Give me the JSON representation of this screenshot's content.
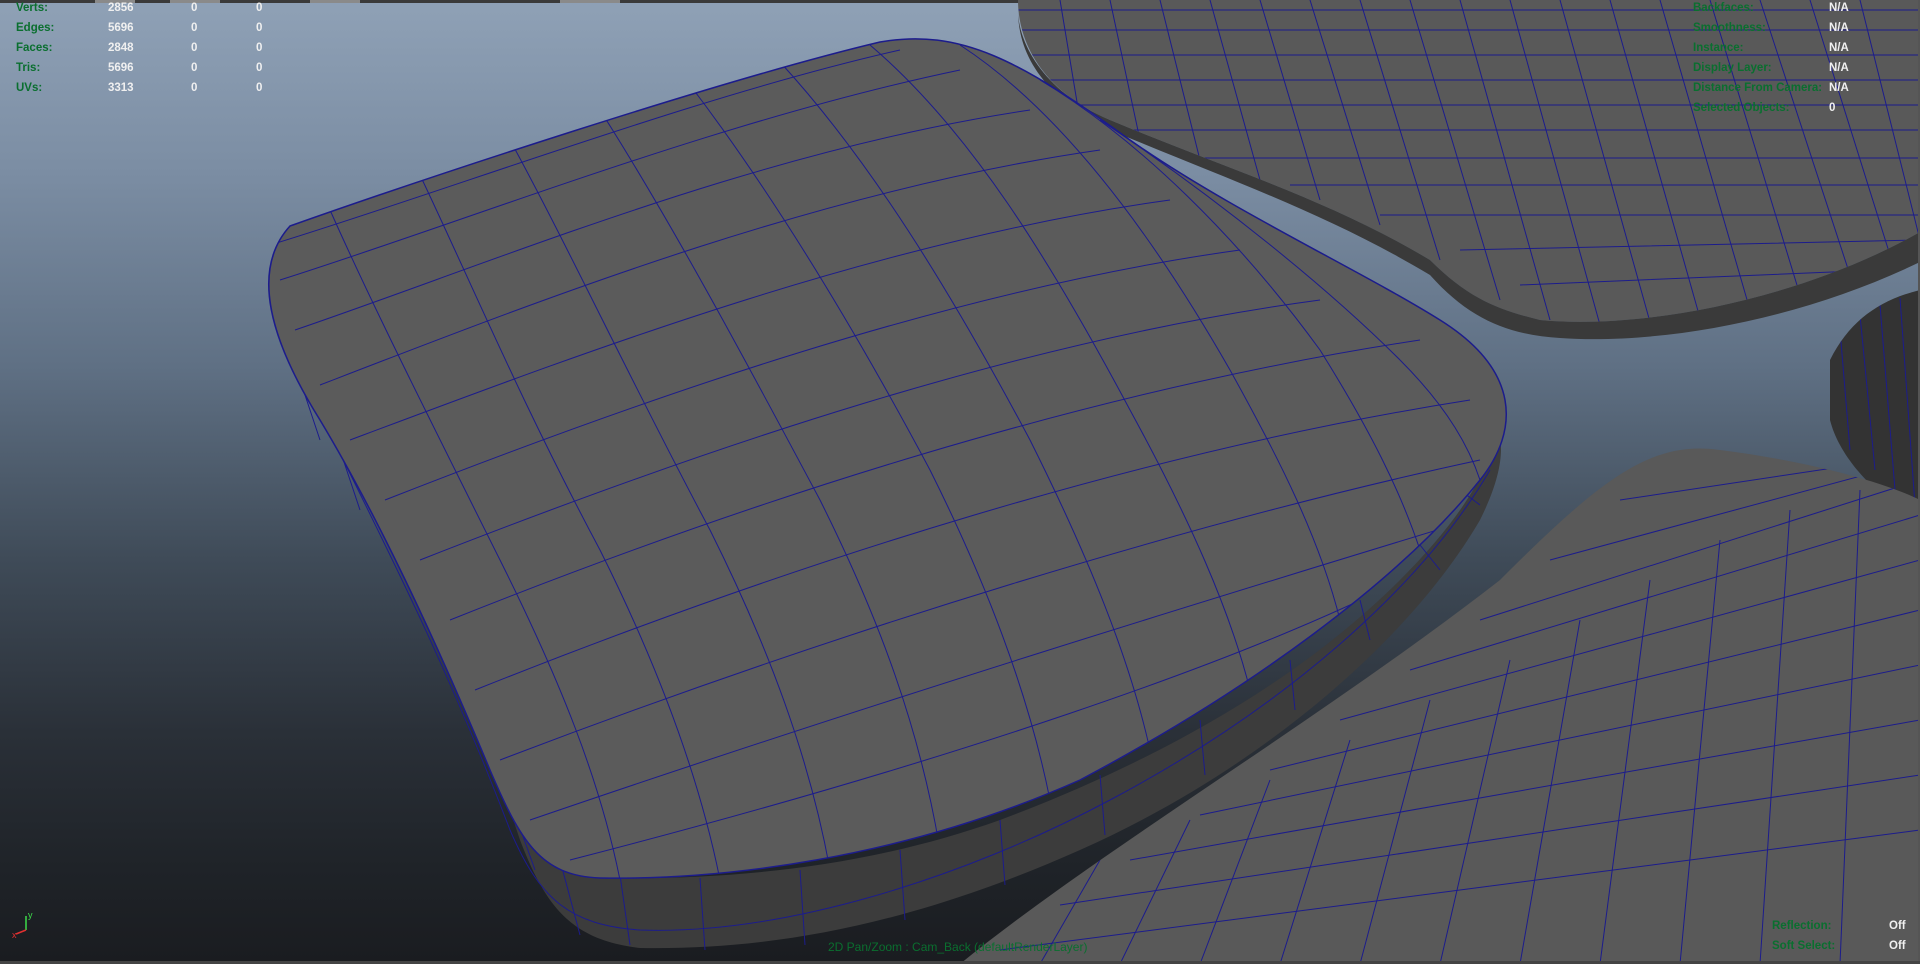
{
  "hud_stats": {
    "rows": [
      {
        "label": "Verts:",
        "total": "2856",
        "selected": "0",
        "triangles": "0"
      },
      {
        "label": "Edges:",
        "total": "5696",
        "selected": "0",
        "triangles": "0"
      },
      {
        "label": "Faces:",
        "total": "2848",
        "selected": "0",
        "triangles": "0"
      },
      {
        "label": "Tris:",
        "total": "5696",
        "selected": "0",
        "triangles": "0"
      },
      {
        "label": "UVs:",
        "total": "3313",
        "selected": "0",
        "triangles": "0"
      }
    ]
  },
  "hud_info": {
    "rows": [
      {
        "label": "Backfaces:",
        "value": "N/A"
      },
      {
        "label": "Smoothness:",
        "value": "N/A"
      },
      {
        "label": "Instance:",
        "value": "N/A"
      },
      {
        "label": "Display Layer:",
        "value": "N/A"
      },
      {
        "label": "Distance From Camera:",
        "value": "N/A"
      },
      {
        "label": "Selected Objects:",
        "value": "0"
      }
    ]
  },
  "hud_bottom_right": {
    "rows": [
      {
        "label": "Reflection:",
        "value": "Off"
      },
      {
        "label": "Soft Select:",
        "value": "Off"
      }
    ]
  },
  "status_line": "2D Pan/Zoom : Cam_Back (defaultRenderLayer)",
  "axis": {
    "y": "y",
    "x": "x"
  },
  "colors": {
    "hud_label": "#0a6f2f",
    "hud_value": "#f0f0f0",
    "mesh_face": "#5b5b5b",
    "wireframe": "#1c1c8c"
  },
  "icons": [
    "view-axis-icon"
  ]
}
